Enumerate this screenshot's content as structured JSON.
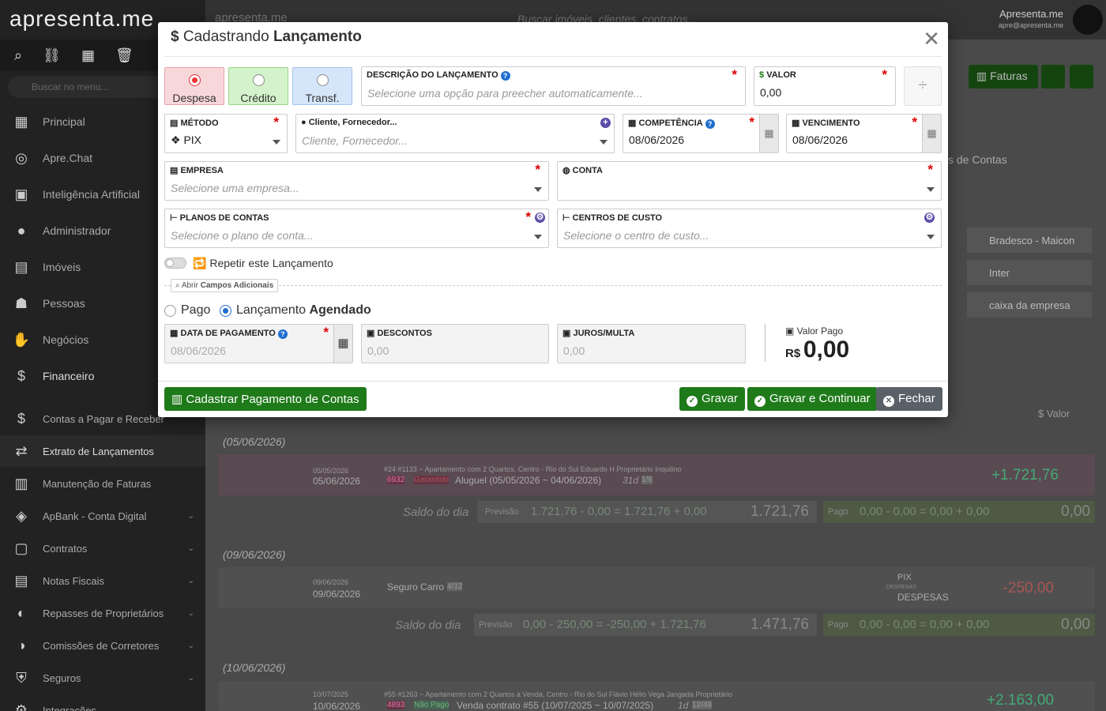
{
  "sidebar": {
    "logo": "apresenta.me",
    "search_placeholder": "Buscar no menu...",
    "items": [
      {
        "label": "Principal"
      },
      {
        "label": "Apre.Chat"
      },
      {
        "label": "Inteligência Artificial"
      },
      {
        "label": "Administrador"
      },
      {
        "label": "Imóveis"
      },
      {
        "label": "Pessoas"
      },
      {
        "label": "Negócios"
      },
      {
        "label": "Financeiro"
      }
    ],
    "sub_items": [
      {
        "label": "Contas a Pagar e Receber"
      },
      {
        "label": "Extrato de Lançamentos"
      },
      {
        "label": "Manutenção de Faturas"
      },
      {
        "label": "ApBank - Conta Digital"
      },
      {
        "label": "Contratos"
      },
      {
        "label": "Notas Fiscais"
      },
      {
        "label": "Repasses de Proprietários"
      },
      {
        "label": "Comissões de Corretores"
      },
      {
        "label": "Seguros"
      },
      {
        "label": "Integrações"
      }
    ]
  },
  "topbar": {
    "search_placeholder": "Buscar imóveis, clientes, contratos...",
    "user_name": "Apresenta.me",
    "user_email": "apre@apresenta.me",
    "faturas_label": "Faturas"
  },
  "background": {
    "planos_label": "s de Contas",
    "valor_header": "Valor",
    "banks": [
      {
        "name": "Bradesco - Maicon"
      },
      {
        "name": "Inter"
      },
      {
        "name": "caixa da empresa"
      }
    ],
    "days": [
      {
        "date": "(05/06/2026)",
        "d1": "05/05/2026",
        "d2": "05/06/2026",
        "info": "#24  #1133 ~ Apartamento com 2 Quartos, Centro - Rio do Sul  Eduardo H  Proprietário  Inquilino",
        "code": "6932",
        "tag": "Garantido",
        "desc": "Aluguel (05/05/2026 ~ 04/06/2026)",
        "extra": "31d",
        "parcel": "1/6",
        "amount": "+1.721,76",
        "saldo_label": "Saldo do dia",
        "prev_label": "Previsão",
        "prev_formula": "1.721,76 - 0,00 = 1.721,76 + 0,00",
        "prev_total": "1.721,76",
        "pago_label": "Pago",
        "pago_formula": "0,00 - 0,00 = 0,00 + 0,00",
        "pago_total": "0,00"
      },
      {
        "date": "(09/06/2026)",
        "d1": "09/06/2026",
        "d2": "09/06/2026",
        "desc": "Seguro Carro",
        "parcel": "4/12",
        "method": "PIX",
        "cat_small": "DESPESAS",
        "cat": "DESPESAS",
        "amount": "-250,00",
        "saldo_label": "Saldo do dia",
        "prev_label": "Previsão",
        "prev_formula": "0,00 - 250,00 = -250,00 + 1.721,76",
        "prev_total": "1.471,76",
        "pago_label": "Pago",
        "pago_formula": "0,00 - 0,00 = 0,00 + 0,00",
        "pago_total": "0,00"
      },
      {
        "date": "(10/06/2026)",
        "d1": "10/07/2025",
        "d2": "10/06/2026",
        "info": "#55  #1263 ~ Apartamento com 2 Quartos à Venda, Centro - Rio do Sul  Flávio Hélio Vega Jangada  Proprietário",
        "code": "4893",
        "tag": "Não Pago",
        "desc": "Venda contrato #55 (10/07/2025 ~ 10/07/2025)",
        "extra": "1d",
        "parcel": "12/48",
        "amount": "+2.163,00"
      }
    ]
  },
  "modal": {
    "title_prefix": "Cadastrando",
    "title_bold": "Lançamento",
    "types": [
      {
        "label": "Despesa",
        "selected": true,
        "color": "#f8d7da"
      },
      {
        "label": "Crédito",
        "selected": false,
        "color": "#d4f3cc"
      },
      {
        "label": "Transf.",
        "selected": false,
        "color": "#d6e6fa"
      }
    ],
    "descricao": {
      "label": "Descrição do Lançamento",
      "placeholder": "Selecione uma opção para preecher automaticamente..."
    },
    "valor": {
      "label": "Valor",
      "value": "0,00"
    },
    "metodo": {
      "label": "Método",
      "value": "PIX"
    },
    "cliente": {
      "label": "Cliente, Fornecedor...",
      "placeholder": "Cliente, Fornecedor..."
    },
    "competencia": {
      "label": "Competência",
      "value": "08/06/2026"
    },
    "vencimento": {
      "label": "Vencimento",
      "value": "08/06/2026"
    },
    "empresa": {
      "label": "Empresa",
      "placeholder": "Selecione uma empresa..."
    },
    "conta": {
      "label": "Conta"
    },
    "planos": {
      "label": "Planos de Contas",
      "placeholder": "Selecione o plano de conta..."
    },
    "centros": {
      "label": "Centros de Custo",
      "placeholder": "Selecione o centro de custo..."
    },
    "repetir_label": "Repetir este Lançamento",
    "abrir_label": "Abrir",
    "campos_label": "Campos Adicionais",
    "status": {
      "pago": "Pago",
      "agendado_prefix": "Lançamento",
      "agendado_bold": "Agendado"
    },
    "data_pagamento": {
      "label": "Data de Pagamento",
      "placeholder": "08/06/2026"
    },
    "descontos": {
      "label": "Descontos",
      "placeholder": "0,00"
    },
    "juros": {
      "label": "Juros/Multa",
      "placeholder": "0,00"
    },
    "valor_pago_label": "Valor Pago",
    "currency": "R$",
    "valor_pago": "0,00",
    "buttons": {
      "cadastrar": "Cadastrar Pagamento de Contas",
      "gravar": "Gravar",
      "gravar_continuar": "Gravar e Continuar",
      "fechar": "Fechar"
    }
  }
}
